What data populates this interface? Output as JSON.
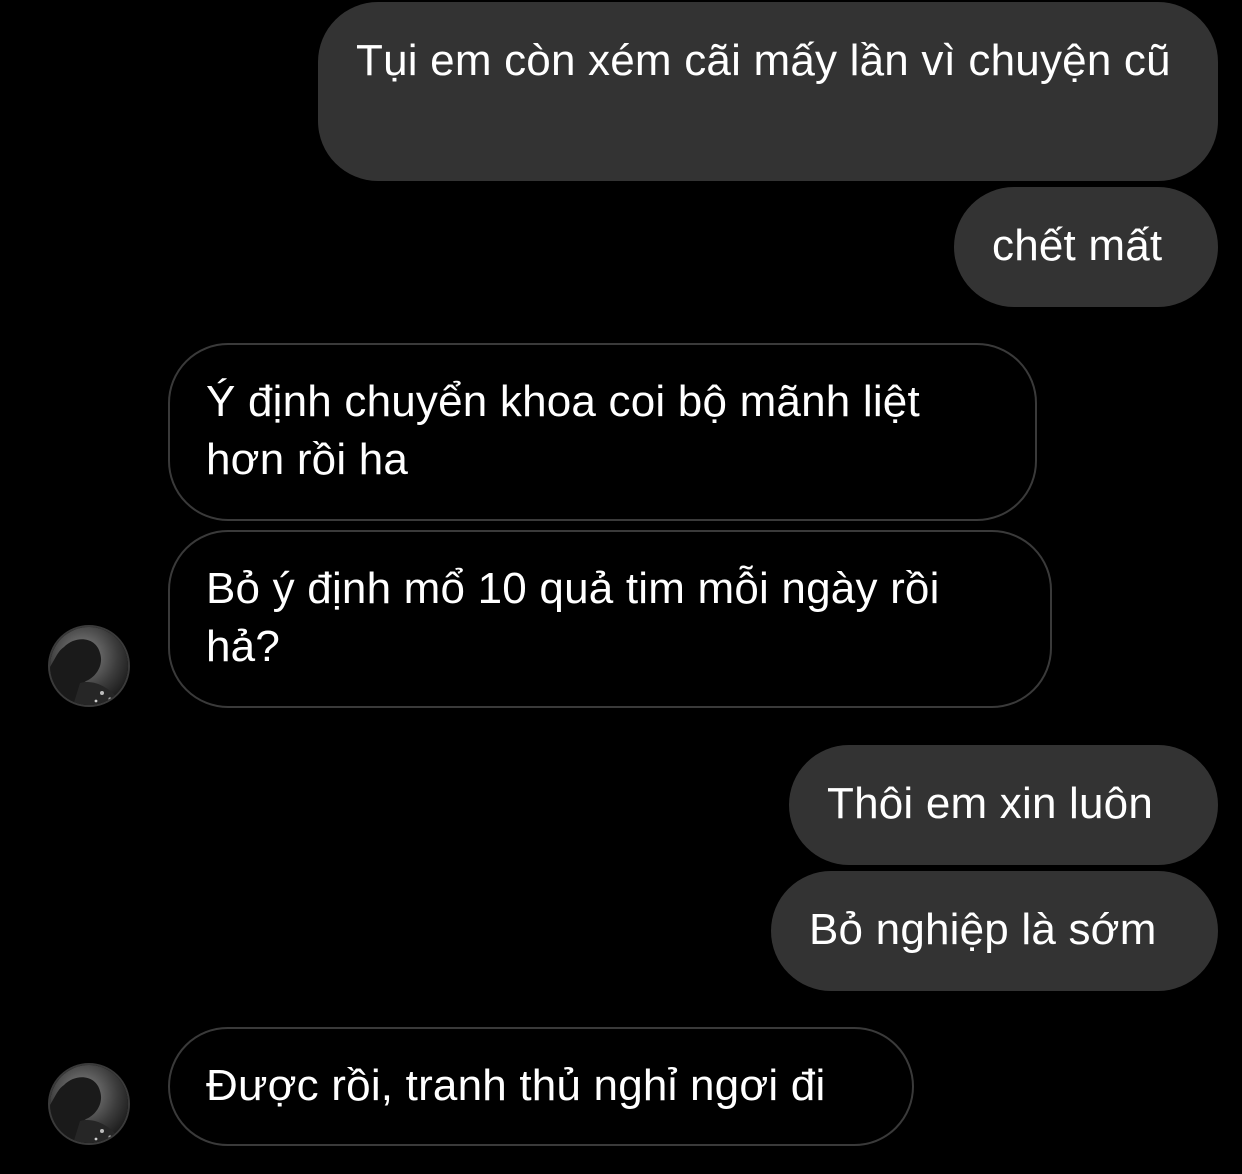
{
  "conversation": {
    "messages": [
      {
        "id": "m1",
        "direction": "sent",
        "text": "Tụi em còn xém cãi mấy lần vì chuyện cũ"
      },
      {
        "id": "m2",
        "direction": "sent",
        "text": "chết mất"
      },
      {
        "id": "m3",
        "direction": "received",
        "text": "Ý định chuyển khoa coi bộ mãnh liệt hơn rồi ha"
      },
      {
        "id": "m4",
        "direction": "received",
        "text": "Bỏ ý định mổ 10 quả tim mỗi ngày rồi hả?"
      },
      {
        "id": "m5",
        "direction": "sent",
        "text": "Thôi em xin luôn"
      },
      {
        "id": "m6",
        "direction": "sent",
        "text": "Bỏ nghiệp là sớm"
      },
      {
        "id": "m7",
        "direction": "received",
        "text": "Được rồi, tranh thủ nghỉ ngơi đi"
      }
    ],
    "contact_avatar_icon": "profile-photo-icon"
  },
  "colors": {
    "background": "#000000",
    "sent_bubble": "#333333",
    "received_border": "#3a3a3a",
    "text": "#ffffff"
  }
}
